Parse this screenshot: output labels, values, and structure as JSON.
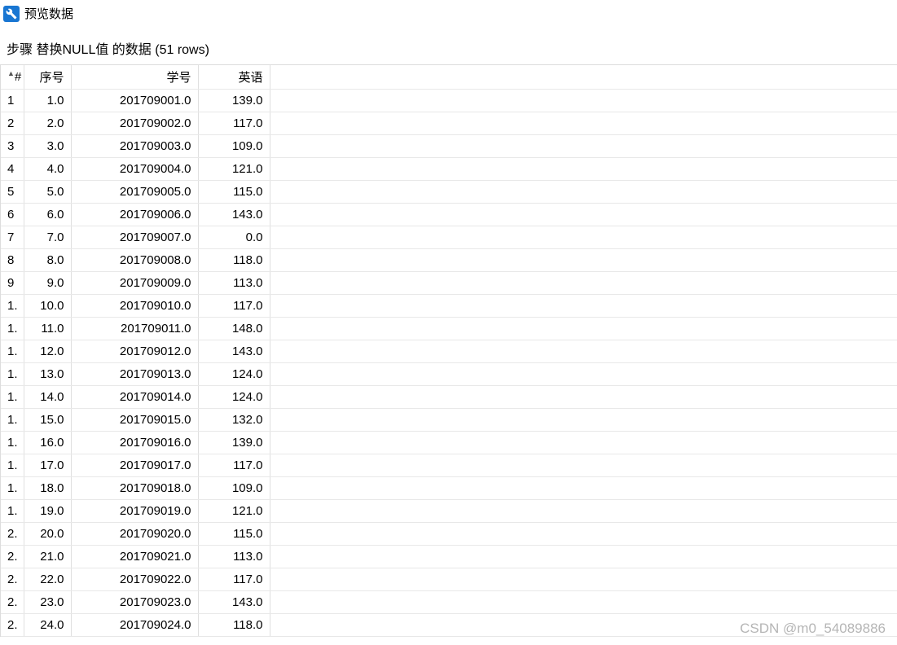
{
  "window": {
    "title": "预览数据"
  },
  "subtitle": "步骤 替换NULL值 的数据  (51 rows)",
  "table": {
    "headers": {
      "index": "#",
      "seq": "序号",
      "id": "学号",
      "en": "英语"
    },
    "rows": [
      {
        "idx": "1",
        "seq": "1.0",
        "id": "201709001.0",
        "en": "139.0"
      },
      {
        "idx": "2",
        "seq": "2.0",
        "id": "201709002.0",
        "en": "117.0"
      },
      {
        "idx": "3",
        "seq": "3.0",
        "id": "201709003.0",
        "en": "109.0"
      },
      {
        "idx": "4",
        "seq": "4.0",
        "id": "201709004.0",
        "en": "121.0"
      },
      {
        "idx": "5",
        "seq": "5.0",
        "id": "201709005.0",
        "en": "115.0"
      },
      {
        "idx": "6",
        "seq": "6.0",
        "id": "201709006.0",
        "en": "143.0"
      },
      {
        "idx": "7",
        "seq": "7.0",
        "id": "201709007.0",
        "en": "0.0"
      },
      {
        "idx": "8",
        "seq": "8.0",
        "id": "201709008.0",
        "en": "118.0"
      },
      {
        "idx": "9",
        "seq": "9.0",
        "id": "201709009.0",
        "en": "113.0"
      },
      {
        "idx": "1.",
        "seq": "10.0",
        "id": "201709010.0",
        "en": "117.0"
      },
      {
        "idx": "1.",
        "seq": "11.0",
        "id": "201709011.0",
        "en": "148.0"
      },
      {
        "idx": "1.",
        "seq": "12.0",
        "id": "201709012.0",
        "en": "143.0"
      },
      {
        "idx": "1.",
        "seq": "13.0",
        "id": "201709013.0",
        "en": "124.0"
      },
      {
        "idx": "1.",
        "seq": "14.0",
        "id": "201709014.0",
        "en": "124.0"
      },
      {
        "idx": "1.",
        "seq": "15.0",
        "id": "201709015.0",
        "en": "132.0"
      },
      {
        "idx": "1.",
        "seq": "16.0",
        "id": "201709016.0",
        "en": "139.0"
      },
      {
        "idx": "1.",
        "seq": "17.0",
        "id": "201709017.0",
        "en": "117.0"
      },
      {
        "idx": "1.",
        "seq": "18.0",
        "id": "201709018.0",
        "en": "109.0"
      },
      {
        "idx": "1.",
        "seq": "19.0",
        "id": "201709019.0",
        "en": "121.0"
      },
      {
        "idx": "2.",
        "seq": "20.0",
        "id": "201709020.0",
        "en": "115.0"
      },
      {
        "idx": "2.",
        "seq": "21.0",
        "id": "201709021.0",
        "en": "113.0"
      },
      {
        "idx": "2.",
        "seq": "22.0",
        "id": "201709022.0",
        "en": "117.0"
      },
      {
        "idx": "2.",
        "seq": "23.0",
        "id": "201709023.0",
        "en": "143.0"
      },
      {
        "idx": "2.",
        "seq": "24.0",
        "id": "201709024.0",
        "en": "118.0"
      }
    ]
  },
  "watermark": "CSDN @m0_54089886"
}
